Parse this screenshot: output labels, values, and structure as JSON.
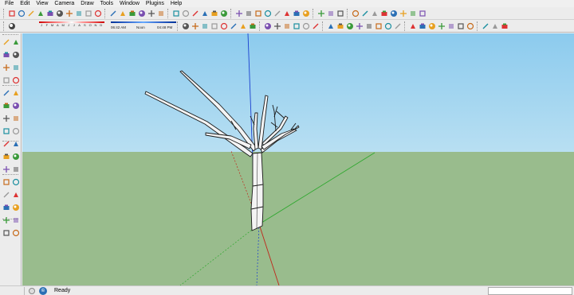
{
  "menu": {
    "items": [
      "File",
      "Edit",
      "View",
      "Camera",
      "Draw",
      "Tools",
      "Window",
      "Plugins",
      "Help"
    ]
  },
  "shadow_settings": {
    "months": [
      "J",
      "F",
      "M",
      "A",
      "M",
      "J",
      "J",
      "A",
      "S",
      "O",
      "N",
      "D"
    ],
    "time_start": "06:42 AM",
    "time_noon": "Noon",
    "time_end": "04:48 PM"
  },
  "status": {
    "text": "Ready",
    "icon_names": [
      "geo-location-icon",
      "credits-icon"
    ]
  },
  "toolbar_icons_row1": [
    "select-icon",
    "make-component-icon",
    "eraser-icon",
    "paint-bucket-icon",
    "rectangle-icon",
    "line-icon",
    "circle-icon",
    "arc-icon",
    "polygon-icon",
    "freehand-icon",
    "move-icon",
    "push-pull-icon",
    "rotate-icon",
    "follow-me-icon",
    "scale-icon",
    "offset-icon",
    "tape-measure-icon",
    "dimension-icon",
    "protractor-icon",
    "text-icon",
    "axes-icon",
    "3d-text-icon",
    "orbit-icon",
    "pan-icon",
    "zoom-icon",
    "zoom-window-icon",
    "zoom-extents-icon",
    "previous-view-icon",
    "next-view-icon",
    "position-camera-icon",
    "walk-icon",
    "look-around-icon",
    "section-plane-icon",
    "get-models-icon",
    "share-model-icon",
    "share-component-icon",
    "add-location-icon",
    "toggle-terrain-icon",
    "photo-textures-icon",
    "preview-google-earth-icon",
    "get-photo-texture-icon"
  ],
  "toolbar_icons_row2": [
    "shadows-toggle-icon",
    "fog-toggle-icon",
    "iso-view-icon",
    "top-view-icon",
    "front-view-icon",
    "right-view-icon",
    "back-view-icon",
    "left-view-icon",
    "xray-icon",
    "back-edges-icon",
    "wireframe-icon",
    "hidden-line-icon",
    "shaded-icon",
    "shaded-textures-icon",
    "monochrome-icon",
    "union-icon",
    "subtract-icon",
    "intersect-icon",
    "trim-icon",
    "split-icon",
    "outer-shell-icon",
    "sandbox-from-contours-icon",
    "sandbox-from-scratch-icon",
    "smoove-icon",
    "stamp-icon",
    "drape-icon",
    "add-detail-icon",
    "flip-edge-icon",
    "record-icon",
    "stop-icon",
    "play-icon",
    "view-icon",
    "layer-icon"
  ],
  "colors": {
    "sky": "#9fd3f0",
    "sky_top": "#8ccbee",
    "ground": "#99bc8d",
    "horizon_haze": "#b8d8e6",
    "blue_axis": "#1a3fcf",
    "green_axis": "#2fa82f",
    "red_axis": "#c0261a",
    "tree_face": "#f4f4f4",
    "tree_edge": "#1a1a1a"
  }
}
